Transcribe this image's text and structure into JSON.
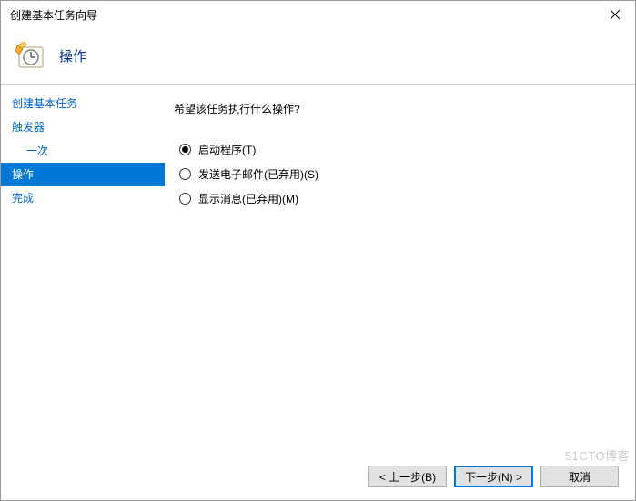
{
  "window": {
    "title": "创建基本任务向导"
  },
  "header": {
    "title": "操作"
  },
  "sidebar": {
    "items": [
      {
        "label": "创建基本任务",
        "indent": false,
        "selected": false
      },
      {
        "label": "触发器",
        "indent": false,
        "selected": false
      },
      {
        "label": "一次",
        "indent": true,
        "selected": false
      },
      {
        "label": "操作",
        "indent": false,
        "selected": true
      },
      {
        "label": "完成",
        "indent": false,
        "selected": false
      }
    ]
  },
  "main": {
    "question": "希望该任务执行什么操作?",
    "options": [
      {
        "label": "启动程序(T)",
        "checked": true
      },
      {
        "label": "发送电子邮件(已弃用)(S)",
        "checked": false
      },
      {
        "label": "显示消息(已弃用)(M)",
        "checked": false
      }
    ]
  },
  "buttons": {
    "back": "< 上一步(B)",
    "next": "下一步(N) >",
    "cancel": "取消"
  },
  "watermark": "51CTO博客"
}
